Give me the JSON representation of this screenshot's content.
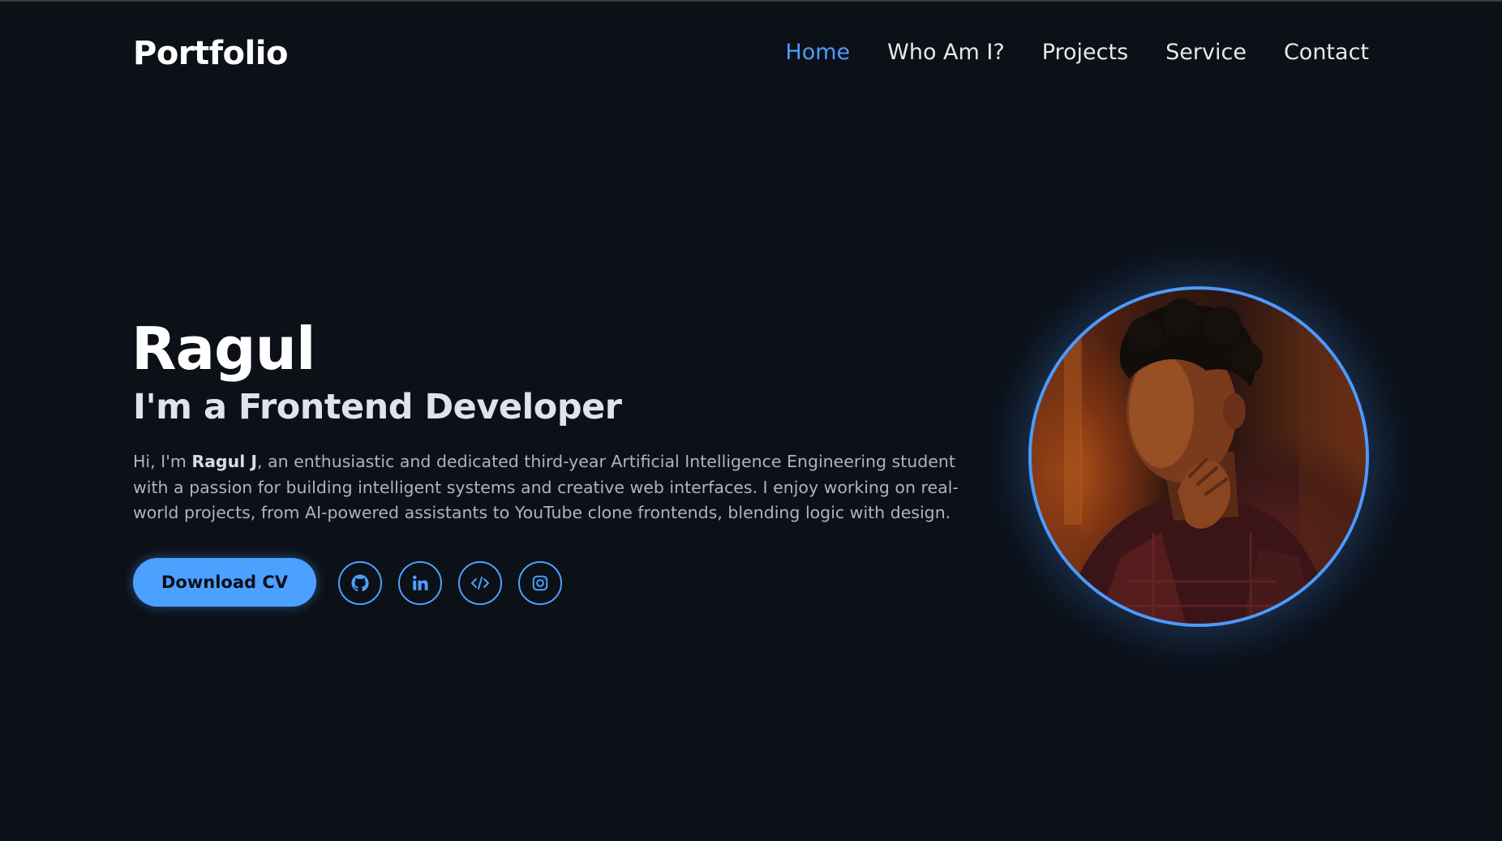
{
  "header": {
    "logo": "Portfolio",
    "nav": [
      {
        "label": "Home",
        "active": true
      },
      {
        "label": "Who Am I?",
        "active": false
      },
      {
        "label": "Projects",
        "active": false
      },
      {
        "label": "Service",
        "active": false
      },
      {
        "label": "Contact",
        "active": false
      }
    ]
  },
  "hero": {
    "name": "Ragul",
    "role": "I'm a Frontend Developer",
    "description": {
      "prefix": "Hi, I'm ",
      "highlight": "Ragul J",
      "suffix": ", an enthusiastic and dedicated third-year Artificial Intelligence Engineering student with a passion for building intelligent systems and creative web interfaces. I enjoy working on real-world projects, from AI-powered assistants to YouTube clone frontends, blending logic with design."
    },
    "cv_button": "Download CV",
    "socials": [
      {
        "name": "github-icon"
      },
      {
        "name": "linkedin-icon"
      },
      {
        "name": "code-icon"
      },
      {
        "name": "instagram-icon"
      }
    ],
    "photo": {
      "alt": "profile-photo"
    }
  },
  "colors": {
    "background": "#0c1017",
    "accent": "#4c9bff",
    "text": "#ffffff",
    "muted": "#aeb4bd"
  }
}
